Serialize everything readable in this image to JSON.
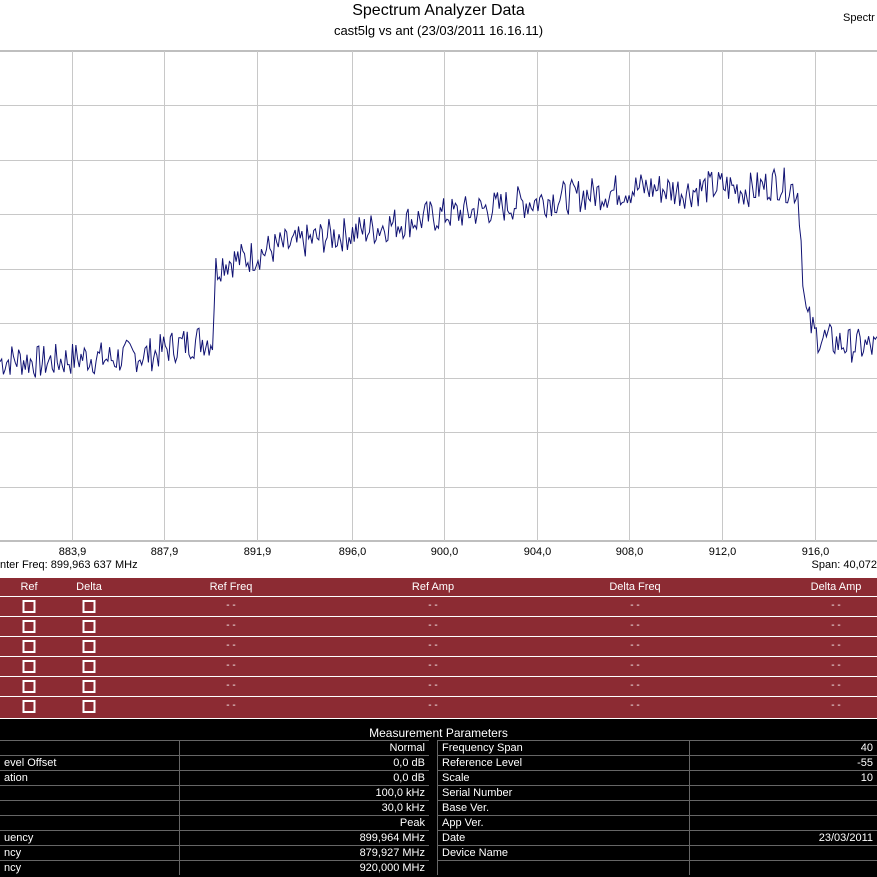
{
  "chart_data": {
    "type": "line",
    "title": "Spectrum Analyzer Data",
    "subtitle": "cast5lg vs ant (23/03/2011 16.16.11)",
    "x_ticks": [
      "883,9",
      "887,9",
      "891,9",
      "896,0",
      "900,0",
      "904,0",
      "908,0",
      "912,0",
      "916,0"
    ],
    "x_tick_values": [
      883.9,
      887.9,
      891.9,
      896.0,
      900.0,
      904.0,
      908.0,
      912.0,
      916.0
    ],
    "xlim": [
      880.8,
      918.7
    ],
    "ylim": [
      -100,
      -55
    ],
    "grid": true,
    "series": [
      {
        "color": "#101273",
        "x": [
          880.8,
          881.5,
          882.5,
          883.5,
          884.5,
          885.5,
          886.5,
          887.5,
          888.0,
          888.5,
          889.0,
          889.5,
          890.0,
          890.1,
          890.5,
          891.0,
          891.5,
          892.0,
          892.5,
          893.0,
          893.5,
          894.0,
          894.5,
          895.0,
          895.5,
          896.0,
          896.5,
          897.0,
          897.5,
          898.0,
          898.5,
          899.0,
          899.5,
          900.0,
          900.5,
          901.0,
          901.5,
          902.0,
          902.5,
          903.0,
          903.5,
          904.0,
          904.5,
          905.0,
          905.5,
          906.0,
          906.5,
          907.0,
          907.5,
          908.0,
          908.5,
          909.0,
          909.5,
          910.0,
          910.5,
          911.0,
          911.5,
          912.0,
          912.5,
          913.0,
          913.5,
          914.0,
          914.3,
          914.8,
          915.0,
          915.3,
          915.6,
          916.0,
          916.5,
          917.0,
          917.5,
          918.0,
          918.7
        ],
        "values": [
          -83.5,
          -83.3,
          -83.6,
          -83.4,
          -83.1,
          -83.3,
          -83.0,
          -82.8,
          -82.3,
          -82.0,
          -81.8,
          -81.5,
          -81.6,
          -75.0,
          -74.3,
          -74.2,
          -74.0,
          -73.6,
          -73.2,
          -72.9,
          -72.8,
          -72.5,
          -72.2,
          -72.0,
          -71.9,
          -71.7,
          -71.5,
          -71.3,
          -71.0,
          -70.8,
          -70.6,
          -70.4,
          -70.2,
          -70.0,
          -69.9,
          -69.8,
          -69.6,
          -69.4,
          -69.3,
          -69.0,
          -68.9,
          -68.8,
          -68.6,
          -68.5,
          -68.4,
          -68.2,
          -68.1,
          -68.0,
          -67.8,
          -67.7,
          -67.6,
          -67.6,
          -67.7,
          -67.8,
          -67.9,
          -67.7,
          -67.5,
          -67.4,
          -67.6,
          -67.8,
          -67.6,
          -67.3,
          -67.0,
          -67.4,
          -67.5,
          -68.0,
          -79.0,
          -81.0,
          -81.5,
          -81.8,
          -82.0,
          -82.1,
          -82.3
        ]
      }
    ]
  },
  "footer": {
    "center_freq": "nter Freq: 899,963 637 MHz",
    "span": "Span: 40,072",
    "corner_label": "Spectr"
  },
  "markers": {
    "headers": [
      "Ref",
      "Delta",
      "Ref Freq",
      "Ref Amp",
      "Delta Freq",
      "Delta Amp"
    ],
    "rows": [
      [
        "- -",
        "- -",
        "- -",
        "- -"
      ],
      [
        "- -",
        "- -",
        "- -",
        "- -"
      ],
      [
        "- -",
        "- -",
        "- -",
        "- -"
      ],
      [
        "- -",
        "- -",
        "- -",
        "- -"
      ],
      [
        "- -",
        "- -",
        "- -",
        "- -"
      ],
      [
        "- -",
        "- -",
        "- -",
        "- -"
      ]
    ]
  },
  "params": {
    "title": "Measurement Parameters",
    "rows": [
      [
        "",
        "Normal",
        "Frequency Span",
        "40"
      ],
      [
        "evel Offset",
        "0,0 dB",
        "Reference Level",
        "-55"
      ],
      [
        "ation",
        "0,0 dB",
        "Scale",
        "10"
      ],
      [
        "",
        "100,0 kHz",
        "Serial Number",
        ""
      ],
      [
        "",
        "30,0 kHz",
        "Base Ver.",
        ""
      ],
      [
        "",
        "Peak",
        "App Ver.",
        ""
      ],
      [
        "uency",
        "899,964 MHz",
        "Date",
        "23/03/2011"
      ],
      [
        "ncy",
        "879,927 MHz",
        "Device Name",
        ""
      ],
      [
        "ncy",
        "920,000 MHz",
        "",
        ""
      ]
    ]
  }
}
